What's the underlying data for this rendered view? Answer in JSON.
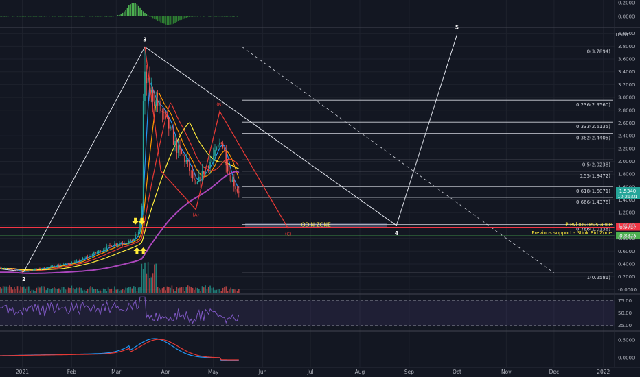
{
  "chart_data": {
    "type": "candlestick",
    "title": "",
    "price_axis": {
      "unit": "USDT",
      "ticks": [
        "4.0000",
        "3.8000",
        "3.6000",
        "3.4000",
        "3.2000",
        "3.0000",
        "2.8000",
        "2.6000",
        "2.4000",
        "2.2000",
        "2.0000",
        "1.8000",
        "1.6000",
        "1.4000",
        "1.2000",
        "1.0000",
        "0.8000",
        "0.6000",
        "0.4000",
        "0.2000",
        "-0.0000"
      ],
      "range": [
        -0.05,
        4.05
      ]
    },
    "time_axis": {
      "ticks": [
        "2021",
        "Feb",
        "Mar",
        "Apr",
        "May",
        "Jun",
        "Jul",
        "Aug",
        "Sep",
        "Oct",
        "Nov",
        "Dec",
        "2022"
      ],
      "range": [
        "2020-12-18",
        "2022-01-08"
      ]
    },
    "last_price": {
      "value": "1.5340",
      "countdown": "10:29:01",
      "color": "#26a69a"
    },
    "fib_levels": [
      {
        "label": "0(3.7894)",
        "value": 3.7894
      },
      {
        "label": "0.236(2.9560)",
        "value": 2.956
      },
      {
        "label": "0.333(2.6135)",
        "value": 2.6135
      },
      {
        "label": "0.382(2.4405)",
        "value": 2.4405
      },
      {
        "label": "0.5(2.0238)",
        "value": 2.0238
      },
      {
        "label": "0.55(1.8472)",
        "value": 1.8472
      },
      {
        "label": "0.618(1.6071)",
        "value": 1.6071
      },
      {
        "label": "0.666(1.4376)",
        "value": 1.4376
      },
      {
        "label": "0.786(1.0138)",
        "value": 1.0138
      },
      {
        "label": "1(0.2581)",
        "value": 0.2581
      }
    ],
    "horizontal_levels": [
      {
        "label": "Previous resistance",
        "value": 0.9717,
        "value_label": "0.9717",
        "color": "#f23645"
      },
      {
        "label": "Previous support - Stink Bid Zone",
        "value": 0.8375,
        "value_label": "0.8375",
        "color": "#4caf50"
      }
    ],
    "zone": {
      "label": "ODIN ZONE",
      "from": "2021-05-21",
      "to": "2021-08-18",
      "low": 0.97,
      "high": 1.04
    },
    "elliott_waves": [
      {
        "label": "2",
        "date": "2021-01-02",
        "value": 0.28
      },
      {
        "label": "3",
        "date": "2021-03-19",
        "value": 3.79
      },
      {
        "label": "4",
        "date": "2021-08-24",
        "value": 1.0
      },
      {
        "label": "5",
        "date": "2021-10-01",
        "value": 3.98
      }
    ],
    "corrective_waves": [
      {
        "label": "(A)",
        "date": "2021-04-20",
        "value": 1.25
      },
      {
        "label": "(B)",
        "date": "2021-05-05",
        "value": 2.78
      },
      {
        "label": "(C)",
        "date": "2021-06-17",
        "value": 0.95
      }
    ],
    "corrective_wave_extra": [
      {
        "date": "2021-03-29",
        "value": 1.85
      }
    ],
    "oscillator_ticks": {
      "top": [
        "0.2000",
        "0.0000"
      ],
      "rsi": [
        "75.00",
        "50.00",
        "25.00"
      ],
      "bottom": [
        "0.5000",
        "0.0000"
      ]
    },
    "colors": {
      "bg": "#131722",
      "up": "#26a69a",
      "down": "#ef5350",
      "ma_blue": "#2196f3",
      "ma_orange": "#ff9800",
      "ma_red": "#e53935",
      "ma_yellow": "#ffeb3b",
      "ma_purple": "#ab47bc",
      "rsi": "#7e57c2",
      "fib": "#d1d4dc",
      "arrow": "#ffeb3b"
    }
  }
}
